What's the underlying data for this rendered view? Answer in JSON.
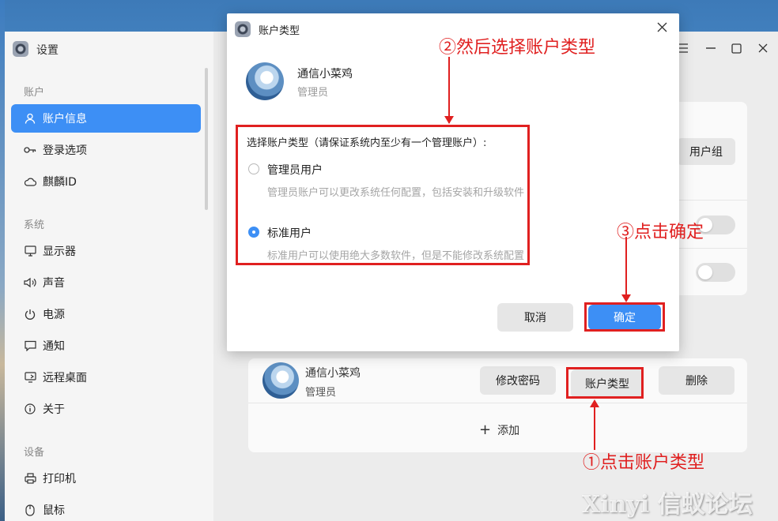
{
  "window": {
    "title": "设置",
    "sidebar": {
      "sections": [
        {
          "label": "账户",
          "items": [
            {
              "label": "账户信息",
              "icon": "user-icon",
              "active": true
            },
            {
              "label": "登录选项",
              "icon": "key-icon"
            },
            {
              "label": "麒麟ID",
              "icon": "cloud-icon"
            }
          ]
        },
        {
          "label": "系统",
          "items": [
            {
              "label": "显示器",
              "icon": "monitor-icon"
            },
            {
              "label": "声音",
              "icon": "speaker-icon"
            },
            {
              "label": "电源",
              "icon": "power-icon"
            },
            {
              "label": "通知",
              "icon": "chat-icon"
            },
            {
              "label": "远程桌面",
              "icon": "remote-desktop-icon"
            },
            {
              "label": "关于",
              "icon": "info-icon"
            }
          ]
        },
        {
          "label": "设备",
          "items": [
            {
              "label": "打印机",
              "icon": "printer-icon"
            },
            {
              "label": "鼠标",
              "icon": "mouse-icon"
            }
          ]
        }
      ]
    },
    "main": {
      "group_button": "用户组",
      "user": {
        "name": "通信小菜鸡",
        "role": "管理员"
      },
      "buttons": {
        "change_password": "修改密码",
        "account_type": "账户类型",
        "delete": "删除"
      },
      "add_label": "添加"
    }
  },
  "dialog": {
    "title": "账户类型",
    "user": {
      "name": "通信小菜鸡",
      "role": "管理员"
    },
    "prompt": "选择账户类型（请保证系统内至少有一个管理账户）:",
    "options": [
      {
        "label": "管理员用户",
        "hint": "管理员账户可以更改系统任何配置，包括安装和升级软件",
        "checked": false
      },
      {
        "label": "标准用户",
        "hint": "标准用户可以使用绝大多数软件，但是不能修改系统配置",
        "checked": true
      }
    ],
    "cancel": "取消",
    "confirm": "确定"
  },
  "annotations": {
    "step1": "①点击账户类型",
    "step2": "②然后选择账户类型",
    "step3": "③点击确定"
  },
  "watermark": "Xinyi 信蚁论坛",
  "colors": {
    "accent": "#3d8ff5",
    "annotation": "#e02020"
  }
}
